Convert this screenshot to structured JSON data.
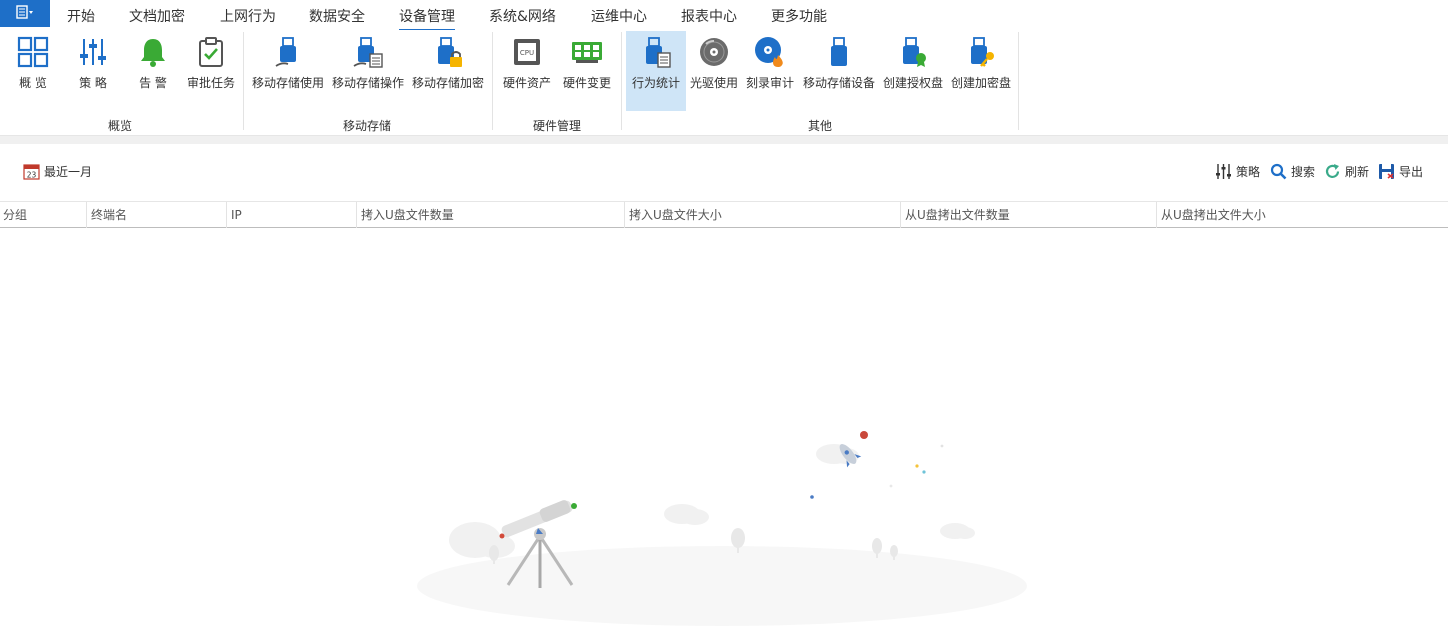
{
  "app_button": {
    "icon": "app-menu-icon"
  },
  "menu": {
    "tabs": [
      {
        "label": "开始"
      },
      {
        "label": "文档加密"
      },
      {
        "label": "上网行为"
      },
      {
        "label": "数据安全"
      },
      {
        "label": "设备管理",
        "active": true
      },
      {
        "label": "系统&网络"
      },
      {
        "label": "运维中心"
      },
      {
        "label": "报表中心"
      },
      {
        "label": "更多功能"
      }
    ]
  },
  "ribbon": {
    "groups": [
      {
        "label": "概览"
      },
      {
        "label": "移动存储"
      },
      {
        "label": "硬件管理"
      },
      {
        "label": "其他"
      }
    ],
    "buttons": [
      {
        "label": "概 览",
        "icon": "overview-grid-icon"
      },
      {
        "label": "策 略",
        "icon": "policy-sliders-icon"
      },
      {
        "label": "告 警",
        "icon": "alarm-bell-icon"
      },
      {
        "label": "审批任务",
        "icon": "approval-clipboard-icon"
      },
      {
        "label": "移动存储使用",
        "icon": "usb-usage-icon"
      },
      {
        "label": "移动存储操作",
        "icon": "usb-operation-icon"
      },
      {
        "label": "移动存储加密",
        "icon": "usb-encrypt-icon"
      },
      {
        "label": "硬件资产",
        "icon": "cpu-icon"
      },
      {
        "label": "硬件变更",
        "icon": "hardware-change-icon"
      },
      {
        "label": "行为统计",
        "icon": "usb-statistics-icon",
        "active": true
      },
      {
        "label": "光驱使用",
        "icon": "optical-disc-icon"
      },
      {
        "label": "刻录审计",
        "icon": "burn-disc-icon"
      },
      {
        "label": "移动存储设备",
        "icon": "usb-device-icon"
      },
      {
        "label": "创建授权盘",
        "icon": "usb-authorize-icon"
      },
      {
        "label": "创建加密盘",
        "icon": "usb-key-icon"
      }
    ]
  },
  "toolbar": {
    "date_range": {
      "label": "最近一月",
      "icon": "calendar-icon",
      "icon_text": "23"
    },
    "policy": {
      "label": "策略",
      "icon": "sliders-icon"
    },
    "search": {
      "label": "搜索",
      "icon": "search-icon"
    },
    "refresh": {
      "label": "刷新",
      "icon": "refresh-icon"
    },
    "export": {
      "label": "导出",
      "icon": "save-export-icon"
    }
  },
  "table": {
    "columns": [
      "分组",
      "终端名",
      "IP",
      "拷入U盘文件数量",
      "拷入U盘文件大小",
      "从U盘拷出文件数量",
      "从U盘拷出文件大小"
    ],
    "rows": []
  },
  "colors": {
    "accent": "#1e6fc8",
    "active_ribbon": "#cfe5f7",
    "bell_green": "#3aaa35"
  }
}
